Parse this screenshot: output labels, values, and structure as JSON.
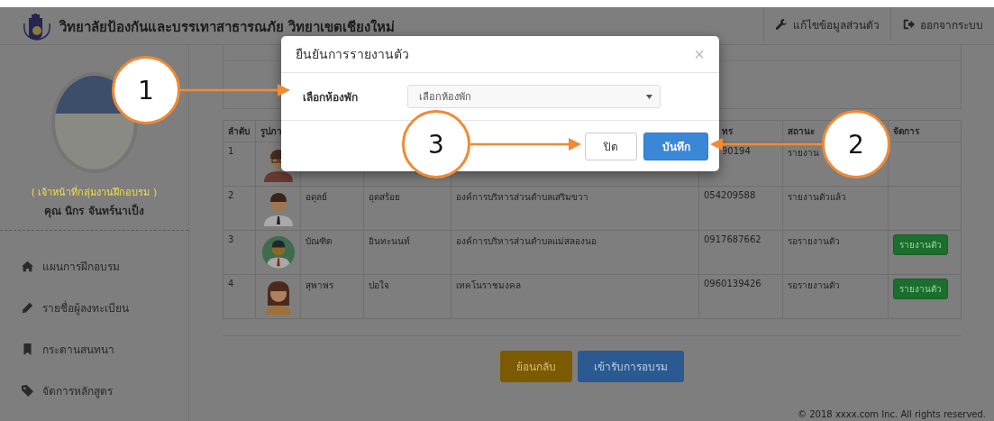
{
  "header": {
    "title": "วิทยาลัยป้องกันและบรรเทาสาธารณภัย วิทยาเขตเชียงใหม่",
    "nav": [
      {
        "label": "แก้ไขข้อมูลส่วนตัว",
        "kind": "edit"
      },
      {
        "label": "ออกจากระบบ",
        "kind": "logout"
      }
    ]
  },
  "sidebar": {
    "role": "( เจ้าหน้าที่กลุ่มงานฝึกอบรม )",
    "name": "คุณ นิกร จันทร์นาเป็ง",
    "menu": [
      {
        "label": "แผนการฝึกอบรม",
        "kind": "home"
      },
      {
        "label": "รายชื่อผู้ลงทะเบียน",
        "kind": "pencil"
      },
      {
        "label": "กระดานสนทนา",
        "kind": "bookmark"
      },
      {
        "label": "จัดการหลักสูตร",
        "kind": "tag"
      }
    ]
  },
  "table": {
    "columns": [
      "ลำดับ",
      "รูปภา",
      "ทร",
      "สถานะ",
      "จัดการ"
    ],
    "rows": [
      {
        "number": "1",
        "kind": "glasses",
        "phone": "90194",
        "status": "รายงาน"
      },
      {
        "number": "2",
        "kind": "tie",
        "first_name": "อดุลย์",
        "last_name": "อุดสร้อย",
        "org": "องค์การบริหารส่วนตำบลเสริมขวา",
        "phone": "054209588",
        "status": "รายงานตัวแล้ว"
      },
      {
        "number": "3",
        "kind": "round",
        "first_name": "บัณฑิต",
        "last_name": "อินทะนนท์",
        "org": "องค์การบริหารส่วนตำบลแม่สลองนอ",
        "phone": "0917687662",
        "status": "รอรายงานตัว",
        "action": "รายงานตัว"
      },
      {
        "number": "4",
        "kind": "woman",
        "first_name": "สุพาพร",
        "last_name": "ปอใจ",
        "org": "เทคโนราชมงคล",
        "phone": "0960139426",
        "status": "รอรายงานตัว",
        "action": "รายงานตัว"
      }
    ]
  },
  "buttons": [
    {
      "label": "ย้อนกลับ",
      "kind": "warning"
    },
    {
      "label": "เข้ารับการอบรม",
      "kind": "primary"
    }
  ],
  "footer": "© 2018 xxxx.com Inc. All rights reserved.",
  "modal": {
    "title": "ยืนยันการรายงานตัว",
    "close": "×",
    "field": {
      "label": "เลือกห้องพัก",
      "placeholder": "เลือกห้องพัก"
    },
    "buttons": [
      {
        "label": "ปิด",
        "kind": "default"
      },
      {
        "label": "บันทึก",
        "kind": "primary"
      }
    ]
  },
  "callouts": [
    {
      "number": "1"
    },
    {
      "number": "2"
    },
    {
      "number": "3"
    }
  ]
}
